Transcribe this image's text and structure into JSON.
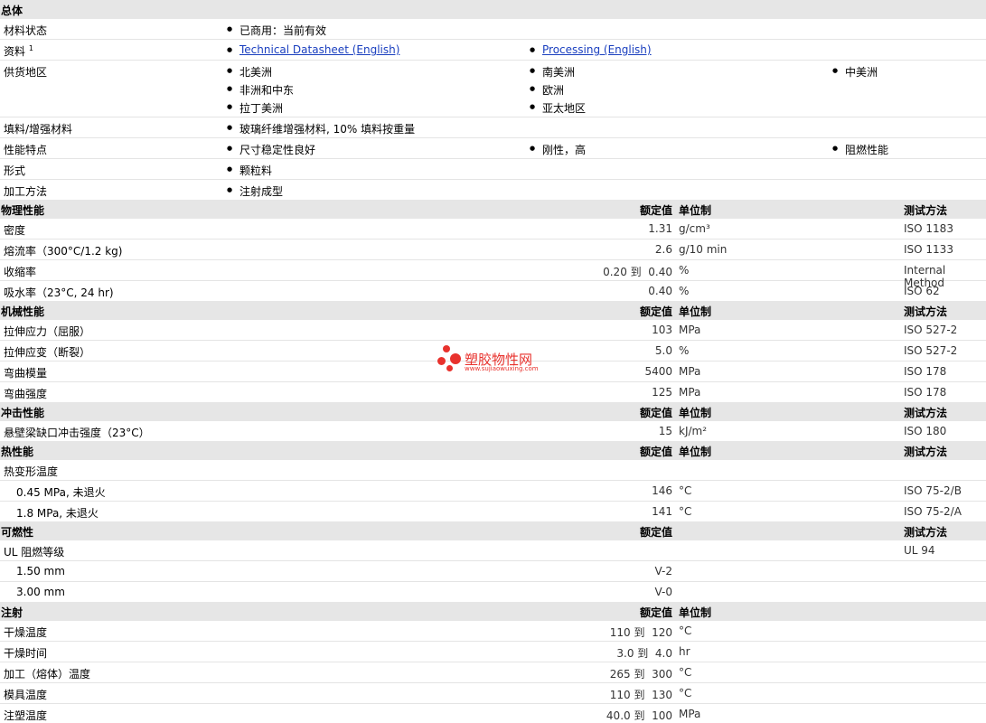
{
  "general": {
    "title": "总体",
    "status_label": "材料状态",
    "status_value": "已商用：当前有效",
    "docs_label": "资料",
    "docs_sup": "1",
    "doc1": "Technical Datasheet (English)",
    "doc2": "Processing (English)",
    "region_label": "供货地区",
    "regions": [
      "北美洲",
      "南美洲",
      "中美洲",
      "非洲和中东",
      "欧洲",
      "拉丁美洲",
      "亚太地区"
    ],
    "filler_label": "填料/增强材料",
    "filler_value": "玻璃纤维增强材料, 10% 填料按重量",
    "feature_label": "性能特点",
    "features": [
      "尺寸稳定性良好",
      "刚性，高",
      "阻燃性能"
    ],
    "form_label": "形式",
    "form_value": "颗粒料",
    "process_label": "加工方法",
    "process_value": "注射成型"
  },
  "headers": {
    "nominal": "额定值",
    "unit": "单位制",
    "test": "测试方法"
  },
  "physical": {
    "title": "物理性能",
    "rows": [
      {
        "label": "密度",
        "value": "1.31",
        "unit": "g/cm³",
        "test": "ISO 1183"
      },
      {
        "label": "熔流率（300°C/1.2 kg)",
        "value": "2.6",
        "unit": "g/10 min",
        "test": "ISO 1133"
      },
      {
        "label": "收缩率",
        "value": "0.20 到  0.40",
        "unit": "%",
        "test": "Internal Method"
      },
      {
        "label": "吸水率（23°C, 24 hr)",
        "value": "0.40",
        "unit": "%",
        "test": "ISO 62"
      }
    ]
  },
  "mechanical": {
    "title": "机械性能",
    "rows": [
      {
        "label": "拉伸应力（屈服）",
        "value": "103",
        "unit": "MPa",
        "test": "ISO 527-2"
      },
      {
        "label": "拉伸应变（断裂）",
        "value": "5.0",
        "unit": "%",
        "test": "ISO 527-2"
      },
      {
        "label": "弯曲模量",
        "value": "5400",
        "unit": "MPa",
        "test": "ISO 178"
      },
      {
        "label": "弯曲强度",
        "value": "125",
        "unit": "MPa",
        "test": "ISO 178"
      }
    ]
  },
  "impact": {
    "title": "冲击性能",
    "rows": [
      {
        "label": "悬壁梁缺口冲击强度（23°C）",
        "value": "15",
        "unit": "kJ/m²",
        "test": "ISO 180"
      }
    ]
  },
  "thermal": {
    "title": "热性能",
    "group": "热变形温度",
    "rows": [
      {
        "label": "0.45 MPa, 未退火",
        "value": "146",
        "unit": "°C",
        "test": "ISO 75-2/B"
      },
      {
        "label": "1.8 MPa, 未退火",
        "value": "141",
        "unit": "°C",
        "test": "ISO 75-2/A"
      }
    ]
  },
  "flammability": {
    "title": "可燃性",
    "group": "UL 阻燃等级",
    "group_test": "UL 94",
    "rows": [
      {
        "label": "1.50 mm",
        "value": "V-2"
      },
      {
        "label": "3.00 mm",
        "value": "V-0"
      }
    ]
  },
  "injection": {
    "title": "注射",
    "rows": [
      {
        "label": "干燥温度",
        "value": "110 到  120",
        "unit": "°C"
      },
      {
        "label": "干燥时间",
        "value": "3.0 到  4.0",
        "unit": "hr"
      },
      {
        "label": "加工（熔体）温度",
        "value": "265 到  300",
        "unit": "°C"
      },
      {
        "label": "模具温度",
        "value": "110 到  130",
        "unit": "°C"
      },
      {
        "label": "注塑温度",
        "value": "40.0 到  100",
        "unit": "MPa"
      }
    ]
  },
  "watermark": {
    "cn": "塑胶物性网",
    "url": "www.sujiaowuxing.com"
  }
}
